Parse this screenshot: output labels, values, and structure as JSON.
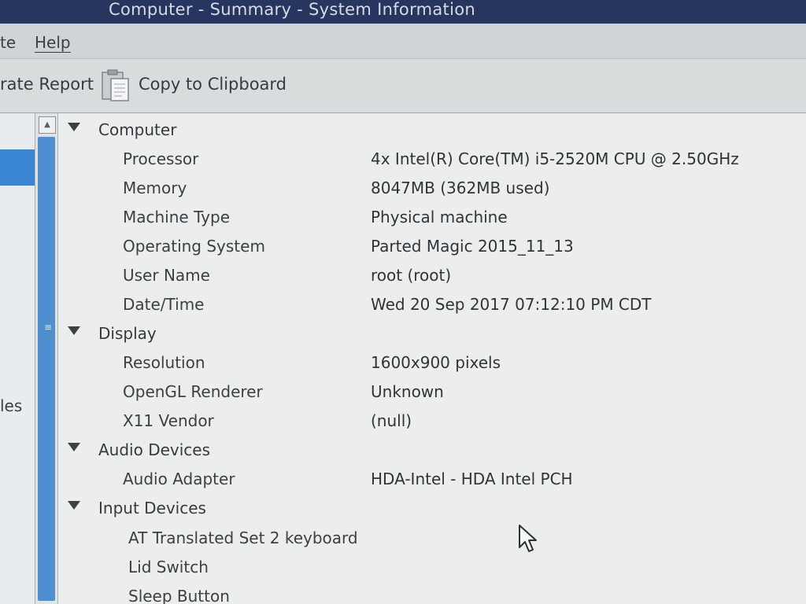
{
  "window": {
    "title": "Computer - Summary - System Information"
  },
  "menubar": {
    "items": [
      "te",
      "Help"
    ]
  },
  "toolbar": {
    "report_label": "rate Report",
    "copy_label": "Copy to Clipboard"
  },
  "sidebar": {
    "partial_label": "les"
  },
  "tree": {
    "sections": [
      {
        "name": "Computer",
        "rows": [
          {
            "key": "Processor",
            "value": "4x Intel(R) Core(TM) i5-2520M CPU @ 2.50GHz"
          },
          {
            "key": "Memory",
            "value": "8047MB (362MB used)"
          },
          {
            "key": "Machine Type",
            "value": "Physical machine"
          },
          {
            "key": "Operating System",
            "value": "Parted Magic 2015_11_13"
          },
          {
            "key": "User Name",
            "value": "root (root)"
          },
          {
            "key": "Date/Time",
            "value": "Wed 20 Sep 2017 07:12:10 PM CDT"
          }
        ]
      },
      {
        "name": "Display",
        "rows": [
          {
            "key": "Resolution",
            "value": "1600x900 pixels"
          },
          {
            "key": "OpenGL Renderer",
            "value": "Unknown"
          },
          {
            "key": "X11 Vendor",
            "value": "(null)"
          }
        ]
      },
      {
        "name": "Audio Devices",
        "rows": [
          {
            "key": "Audio Adapter",
            "value": "HDA-Intel - HDA Intel PCH"
          }
        ]
      },
      {
        "name": "Input Devices",
        "rows": [
          {
            "key": "AT Translated Set 2 keyboard",
            "value": ""
          },
          {
            "key": "Lid Switch",
            "value": ""
          },
          {
            "key": "Sleep Button",
            "value": ""
          }
        ]
      }
    ]
  },
  "colors": {
    "titlebar": "#27365f",
    "selection": "#3a86d4",
    "scroll_thumb": "#4e8fd0"
  }
}
